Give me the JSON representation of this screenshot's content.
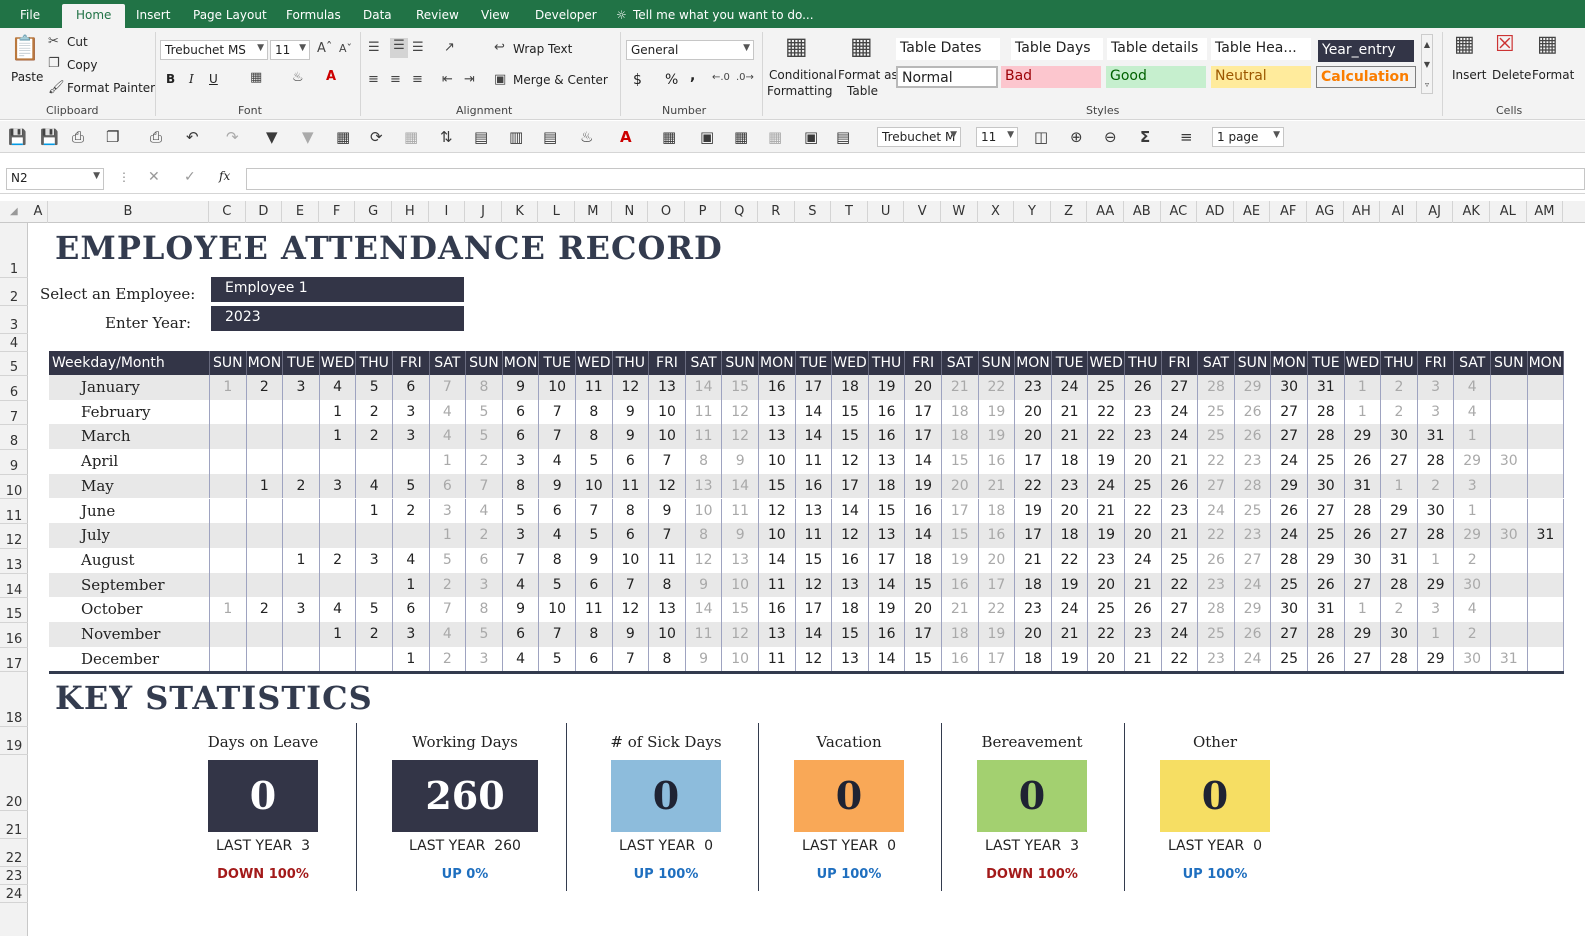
{
  "ribbon": {
    "tabs": [
      "File",
      "Home",
      "Insert",
      "Page Layout",
      "Formulas",
      "Data",
      "Review",
      "View",
      "Developer"
    ],
    "tell_me": "Tell me what you want to do...",
    "clipboard": {
      "paste": "Paste",
      "cut": "Cut",
      "copy": "Copy",
      "format_painter": "Format Painter",
      "label": "Clipboard"
    },
    "font": {
      "name": "Trebuchet MS",
      "size": "11",
      "bold": "B",
      "italic": "I",
      "underline": "U",
      "label": "Font"
    },
    "alignment": {
      "wrap": "Wrap Text",
      "merge": "Merge & Center",
      "label": "Alignment"
    },
    "number": {
      "format": "General",
      "label": "Number",
      "currency": "$",
      "percent": "%",
      "comma": ","
    },
    "styles": {
      "conditional": "Conditional",
      "conditional2": "Formatting",
      "format_as": "Format as",
      "format_as2": "Table",
      "label": "Styles",
      "row1": [
        "Table Dates",
        "Table Days",
        "Table details",
        "Table Hea...",
        "Year_entry"
      ],
      "row2": [
        "Normal",
        "Bad",
        "Good",
        "Neutral",
        "Calculation"
      ]
    },
    "cells": {
      "insert": "Insert",
      "delete": "Delete",
      "format": "Format",
      "label": "Cells"
    }
  },
  "qat": {
    "font": "Trebuchet M",
    "size": "11",
    "page": "1 page"
  },
  "formula_bar": {
    "name_box": "N2",
    "fx": "fx",
    "content": ""
  },
  "columns": [
    "A",
    "B",
    "C",
    "D",
    "E",
    "F",
    "G",
    "H",
    "I",
    "J",
    "K",
    "L",
    "M",
    "N",
    "O",
    "P",
    "Q",
    "R",
    "S",
    "T",
    "U",
    "V",
    "W",
    "X",
    "Y",
    "Z",
    "AA",
    "AB",
    "AC",
    "AD",
    "AE",
    "AF",
    "AG",
    "AH",
    "AI",
    "AJ",
    "AK",
    "AL",
    "AM"
  ],
  "rows": [
    "1",
    "2",
    "3",
    "4",
    "5",
    "6",
    "7",
    "8",
    "9",
    "10",
    "11",
    "12",
    "13",
    "14",
    "15",
    "16",
    "17",
    "18",
    "19",
    "20",
    "21",
    "22",
    "23",
    "24"
  ],
  "sheet": {
    "title": "EMPLOYEE ATTENDANCE RECORD",
    "employee_label": "Select an Employee:",
    "employee_value": "Employee 1",
    "year_label": "Enter Year:",
    "year_value": "2023",
    "stats_title": "KEY STATISTICS"
  },
  "calendar": {
    "corner": "Weekday/Month",
    "weekdays": [
      "SUN",
      "MON",
      "TUE",
      "WED",
      "THU",
      "FRI",
      "SAT",
      "SUN",
      "MON",
      "TUE",
      "WED",
      "THU",
      "FRI",
      "SAT",
      "SUN",
      "MON",
      "TUE",
      "WED",
      "THU",
      "FRI",
      "SAT",
      "SUN",
      "MON",
      "TUE",
      "WED",
      "THU",
      "FRI",
      "SAT",
      "SUN",
      "MON",
      "TUE",
      "WED",
      "THU",
      "FRI",
      "SAT",
      "SUN",
      "MON"
    ],
    "months": [
      {
        "name": "January",
        "start": 0,
        "days": 31,
        "next": 4
      },
      {
        "name": "February",
        "start": 3,
        "days": 28,
        "next": 4
      },
      {
        "name": "March",
        "start": 3,
        "days": 31,
        "next": 1
      },
      {
        "name": "April",
        "start": 6,
        "days": 30,
        "next": 0
      },
      {
        "name": "May",
        "start": 1,
        "days": 31,
        "next": 3
      },
      {
        "name": "June",
        "start": 4,
        "days": 30,
        "next": 1
      },
      {
        "name": "July",
        "start": 6,
        "days": 31,
        "next": 0
      },
      {
        "name": "August",
        "start": 2,
        "days": 31,
        "next": 2
      },
      {
        "name": "September",
        "start": 5,
        "days": 30,
        "next": 0
      },
      {
        "name": "October",
        "start": 0,
        "days": 31,
        "next": 4
      },
      {
        "name": "November",
        "start": 3,
        "days": 30,
        "next": 2
      },
      {
        "name": "December",
        "start": 5,
        "days": 31,
        "next": 0
      }
    ]
  },
  "stats": [
    {
      "title": "Days on Leave",
      "value": "0",
      "last_year": "LAST YEAR  3",
      "change": "DOWN 100%",
      "box_color": "#333547",
      "text_color": "#ffffff",
      "change_color": "#a31a1a"
    },
    {
      "title": "Working Days",
      "value": "260",
      "last_year": "LAST YEAR  260",
      "change": "UP 0%",
      "box_color": "#333547",
      "text_color": "#ffffff",
      "change_color": "#1f6fbf"
    },
    {
      "title": "# of Sick Days",
      "value": "0",
      "last_year": "LAST YEAR  0",
      "change": "UP 100%",
      "box_color": "#8dbcdc",
      "text_color": "#1f2333",
      "change_color": "#1f6fbf"
    },
    {
      "title": "Vacation",
      "value": "0",
      "last_year": "LAST YEAR  0",
      "change": "UP 100%",
      "box_color": "#f9a857",
      "text_color": "#1f2333",
      "change_color": "#1f6fbf"
    },
    {
      "title": "Bereavement",
      "value": "0",
      "last_year": "LAST YEAR  3",
      "change": "DOWN 100%",
      "box_color": "#a3d070",
      "text_color": "#1f2333",
      "change_color": "#a31a1a"
    },
    {
      "title": "Other",
      "value": "0",
      "last_year": "LAST YEAR  0",
      "change": "UP 100%",
      "box_color": "#f6de63",
      "text_color": "#1f2333",
      "change_color": "#1f6fbf"
    }
  ]
}
